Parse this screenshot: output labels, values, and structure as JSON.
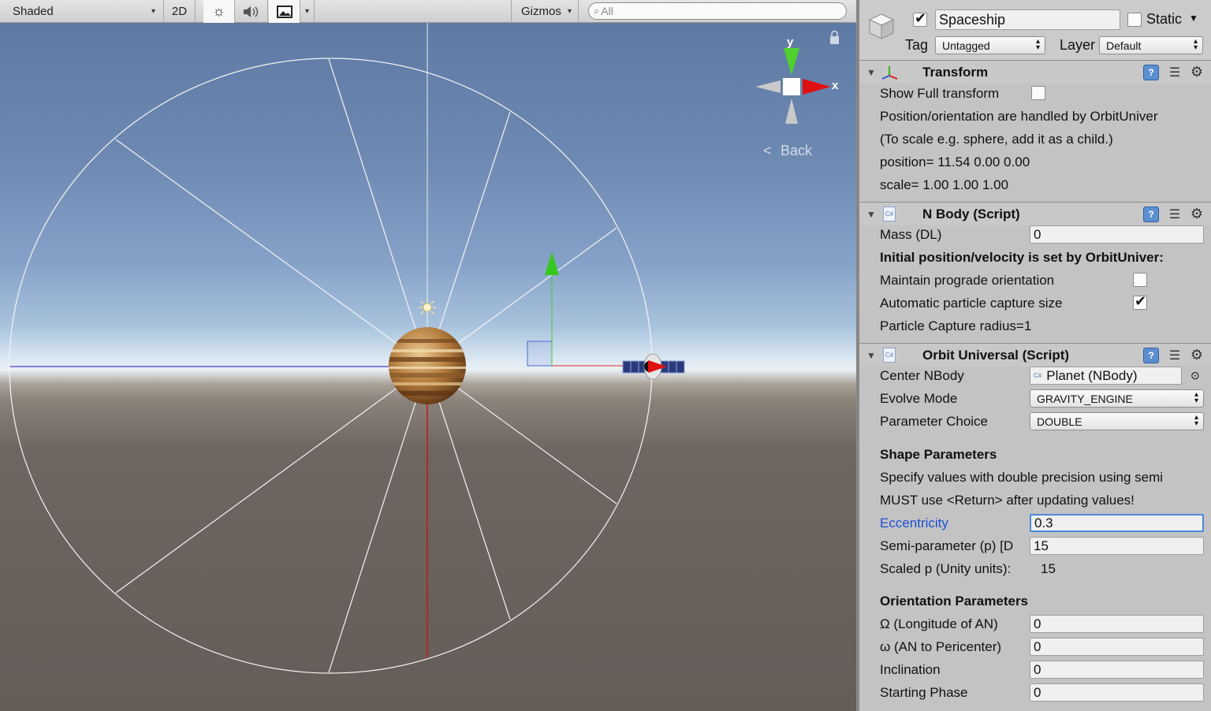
{
  "scene_toolbar": {
    "shading_mode": "Shaded",
    "mode_2d": "2D",
    "gizmos_label": "Gizmos",
    "search_placeholder": "All"
  },
  "scene": {
    "gizmo_axis_y": "y",
    "gizmo_axis_x": "x",
    "back_label": "Back"
  },
  "inspector": {
    "object_name": "Spaceship",
    "active_checked": true,
    "static_label": "Static",
    "static_checked": false,
    "tag_label": "Tag",
    "tag_value": "Untagged",
    "layer_label": "Layer",
    "layer_value": "Default",
    "transform": {
      "title": "Transform",
      "show_full_label": "Show Full transform",
      "show_full_checked": false,
      "note1": "Position/orientation are handled by OrbitUniver",
      "note2": "(To scale e.g. sphere, add it as a child.)",
      "position": "position= 11.54 0.00 0.00",
      "scale": "scale= 1.00 1.00 1.00"
    },
    "nbody": {
      "title": "N Body (Script)",
      "mass_label": "Mass (DL)",
      "mass_value": "0",
      "initial_note": "Initial position/velocity is set by OrbitUniver:",
      "prograde_label": "Maintain prograde orientation",
      "prograde_checked": false,
      "auto_capture_label": "Automatic particle capture size",
      "auto_capture_checked": true,
      "capture_radius": "Particle Capture radius=1"
    },
    "orbit": {
      "title": "Orbit Universal (Script)",
      "center_label": "Center NBody",
      "center_value": "Planet (NBody)",
      "evolve_label": "Evolve Mode",
      "evolve_value": "GRAVITY_ENGINE",
      "param_choice_label": "Parameter Choice",
      "param_choice_value": "DOUBLE",
      "shape_header": "Shape Parameters",
      "shape_note1": "Specify values with double precision using semi",
      "shape_note2": "MUST use <Return> after updating values!",
      "ecc_label": "Eccentricity",
      "ecc_value": "0.3",
      "semi_label": "Semi-parameter (p) [D",
      "semi_value": "15",
      "scaled_p_label": "Scaled p (Unity units):",
      "scaled_p_value": "15",
      "orient_header": "Orientation Parameters",
      "omega_big_label": "Ω (Longitude of AN)",
      "omega_big_value": "0",
      "omega_small_label": "ω (AN to Pericenter)",
      "omega_small_value": "0",
      "incl_label": "Inclination",
      "incl_value": "0",
      "phase_label": "Starting Phase",
      "phase_value": "0"
    }
  },
  "colors": {
    "gizmo_x": "#e01010",
    "gizmo_y": "#33d21a",
    "focus_blue": "#4b8ad8"
  }
}
